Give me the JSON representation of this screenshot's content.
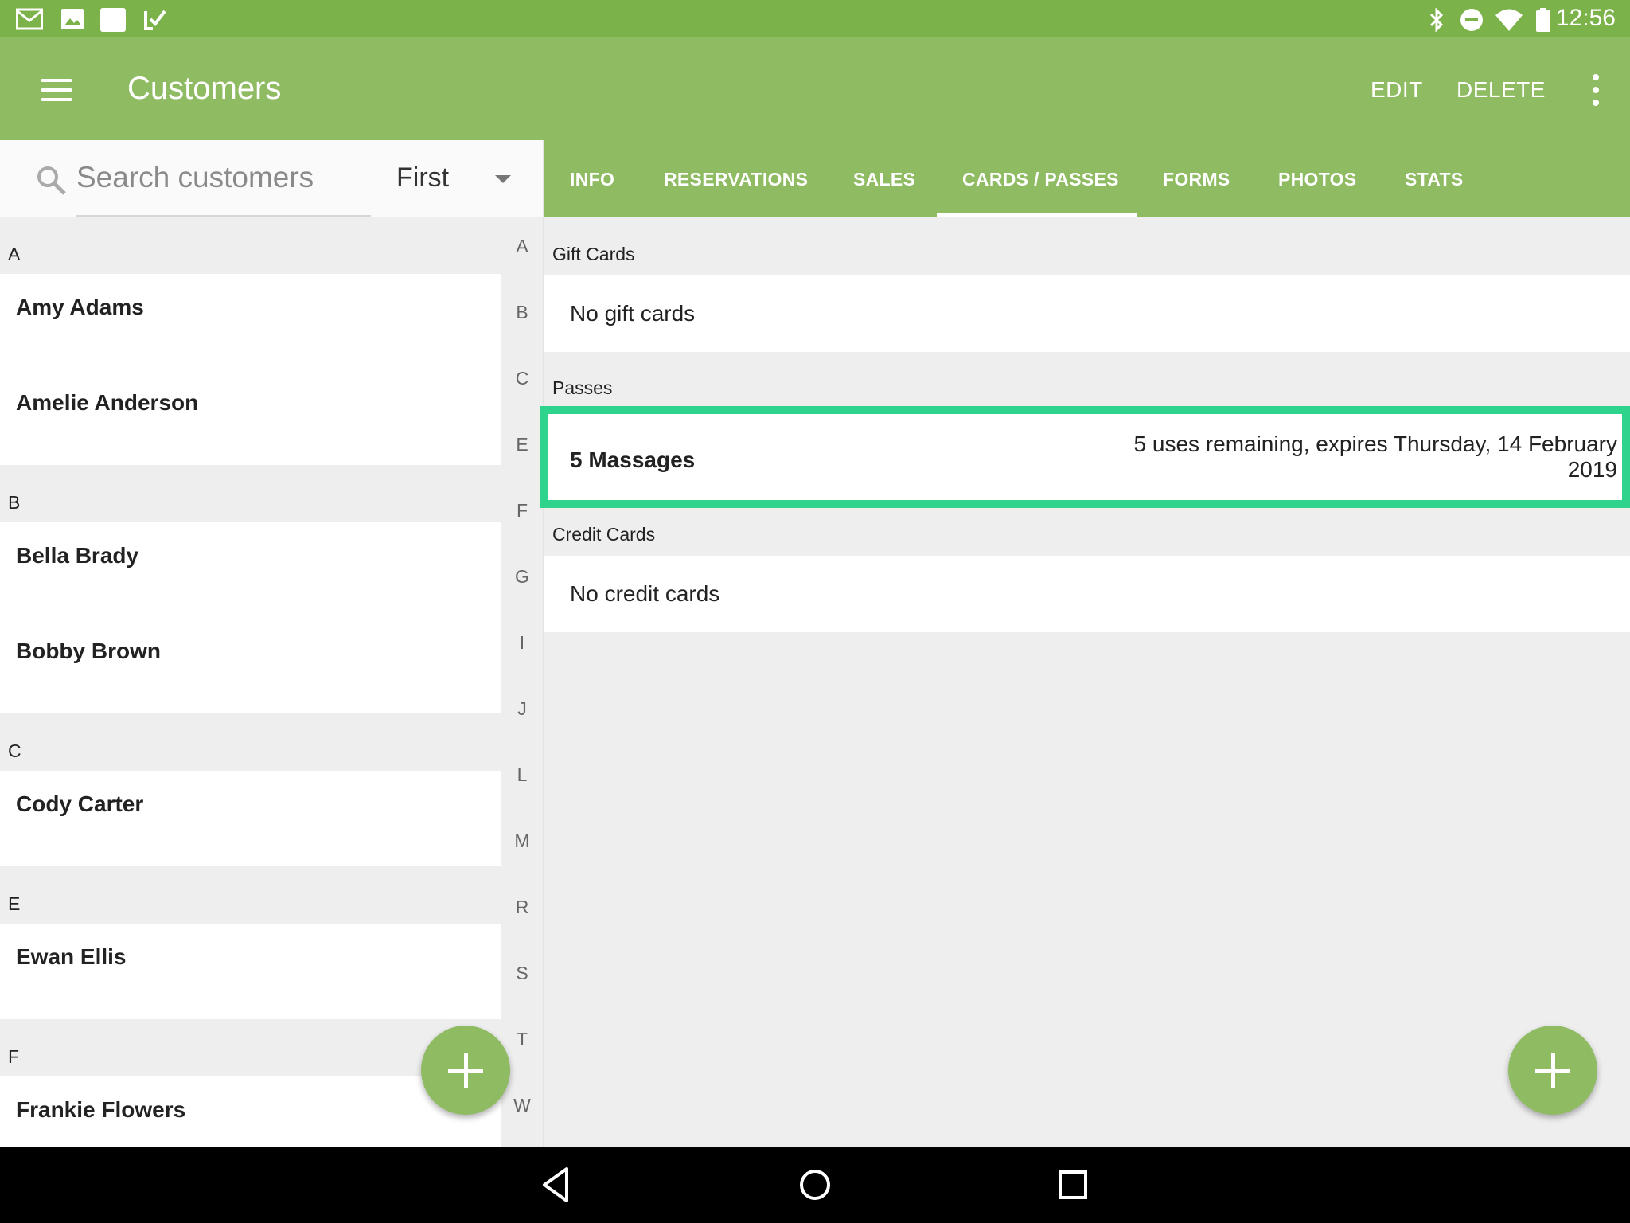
{
  "status_bar": {
    "time": "12:56",
    "left_icons": [
      "gmail-icon",
      "image-icon",
      "note-icon",
      "tasks-icon"
    ],
    "right_icons": [
      "bluetooth-icon",
      "do-not-disturb-icon",
      "wifi-icon",
      "battery-icon"
    ]
  },
  "app_bar": {
    "title": "Customers",
    "edit_label": "EDIT",
    "delete_label": "DELETE"
  },
  "search": {
    "placeholder": "Search customers",
    "value": "",
    "sort_value": "First"
  },
  "customer_list": {
    "sections": [
      {
        "letter": "A",
        "customers": [
          "Amy Adams",
          "Amelie Anderson"
        ]
      },
      {
        "letter": "B",
        "customers": [
          "Bella Brady",
          "Bobby Brown"
        ]
      },
      {
        "letter": "C",
        "customers": [
          "Cody Carter"
        ]
      },
      {
        "letter": "E",
        "customers": [
          "Ewan Ellis"
        ]
      },
      {
        "letter": "F",
        "customers": [
          "Frankie Flowers"
        ]
      }
    ]
  },
  "alpha_index": [
    "A",
    "B",
    "C",
    "E",
    "F",
    "G",
    "I",
    "J",
    "L",
    "M",
    "R",
    "S",
    "T",
    "W"
  ],
  "tabs": [
    {
      "label": "INFO"
    },
    {
      "label": "RESERVATIONS"
    },
    {
      "label": "SALES"
    },
    {
      "label": "CARDS / PASSES",
      "active": true
    },
    {
      "label": "FORMS"
    },
    {
      "label": "PHOTOS"
    },
    {
      "label": "STATS"
    }
  ],
  "cards_passes": {
    "gift_cards": {
      "header": "Gift Cards",
      "empty_text": "No gift cards"
    },
    "passes": {
      "header": "Passes",
      "items": [
        {
          "name": "5 Massages",
          "detail_line1": "5 uses remaining, expires Thursday, 14 February",
          "detail_line2": "2019"
        }
      ]
    },
    "credit_cards": {
      "header": "Credit Cards",
      "empty_text": "No credit cards"
    }
  },
  "colors": {
    "status_bar": "#7cb24a",
    "app_bar": "#8fbb63",
    "highlight_border": "#2ed38c",
    "fab": "#8fbb63"
  }
}
